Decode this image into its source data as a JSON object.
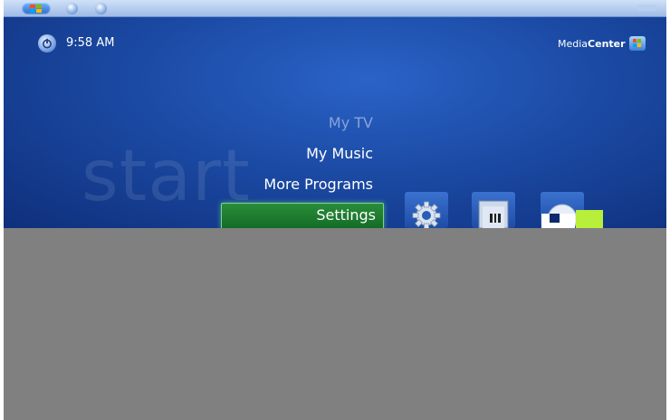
{
  "status": {
    "time": "9:58 AM"
  },
  "brand": {
    "name_light": "Media",
    "name_bold": "Center"
  },
  "watermark": "start",
  "menu": {
    "items": [
      {
        "label": "My TV",
        "state": "dimmed"
      },
      {
        "label": "My Music",
        "state": "normal"
      },
      {
        "label": "More Programs",
        "state": "normal"
      },
      {
        "label": "Settings",
        "state": "selected"
      }
    ]
  },
  "colors": {
    "background": "#1b4aa4",
    "selection": "#1a7a2e",
    "obscured_area": "#808080"
  },
  "icons": [
    "windows-flag-icon",
    "back-icon",
    "forward-icon",
    "power-icon",
    "mediacenter-logo-icon",
    "gear-icon",
    "monitor-icon",
    "sphere-icon"
  ]
}
